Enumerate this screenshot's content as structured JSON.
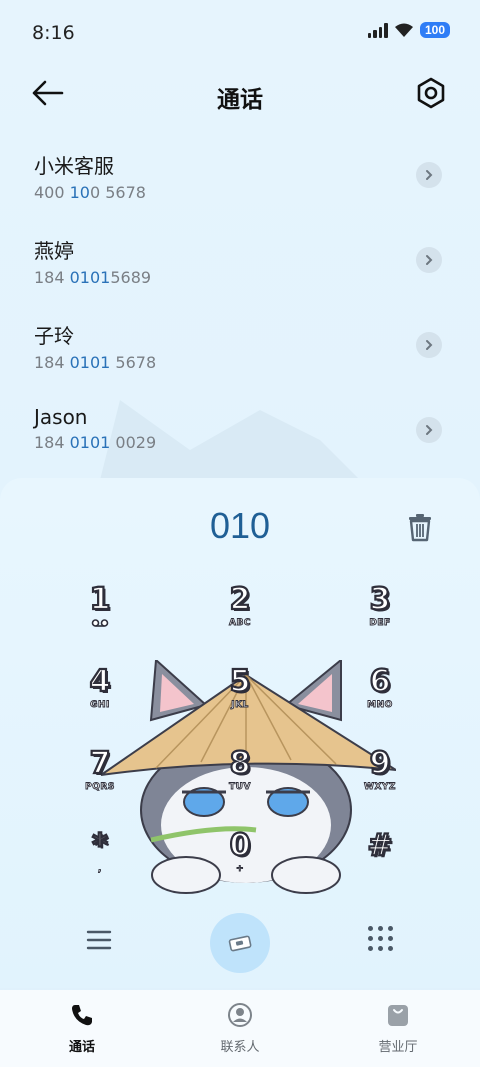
{
  "status": {
    "time": "8:16",
    "battery": "100",
    "icons": [
      "signal-icon",
      "wifi-icon",
      "battery-icon"
    ]
  },
  "header": {
    "title": "通话",
    "back_icon": "arrow-left-icon",
    "settings_icon": "gear-icon"
  },
  "contacts": [
    {
      "name": "小米客服",
      "pre": "400 ",
      "hl": "010",
      "hl2": "0",
      "post": " 5678",
      "numtext": "400 100 5678"
    },
    {
      "name": "燕婷",
      "pre": "184 ",
      "hl": "0101",
      "post": "5689",
      "numtext": "184 01015689"
    },
    {
      "name": "子玲",
      "pre": "184 ",
      "hl": "0101",
      "post": " 5678",
      "numtext": "184 0101 5678"
    },
    {
      "name": "Jason",
      "pre": "184 ",
      "hl": "0101",
      "post": " 0029",
      "numtext": "184 0101 0029"
    }
  ],
  "dialer": {
    "number": "010",
    "delete_icon": "trash-icon"
  },
  "keys": [
    {
      "d": "1",
      "l": "voicemail"
    },
    {
      "d": "2",
      "l": "ABC"
    },
    {
      "d": "3",
      "l": "DEF"
    },
    {
      "d": "4",
      "l": "GHI"
    },
    {
      "d": "5",
      "l": "JKL"
    },
    {
      "d": "6",
      "l": "MNO"
    },
    {
      "d": "7",
      "l": "PQRS"
    },
    {
      "d": "8",
      "l": "TUV"
    },
    {
      "d": "9",
      "l": "WXYZ"
    },
    {
      "d": "*",
      "l": ","
    },
    {
      "d": "0",
      "l": "+"
    },
    {
      "d": "#",
      "l": ""
    }
  ],
  "nav": {
    "calls": "通话",
    "contacts": "联系人",
    "store": "营业厅"
  },
  "colors": {
    "accent": "#2a72b8",
    "dialed": "#1f5f95",
    "call_button": "#bfe3fb"
  }
}
